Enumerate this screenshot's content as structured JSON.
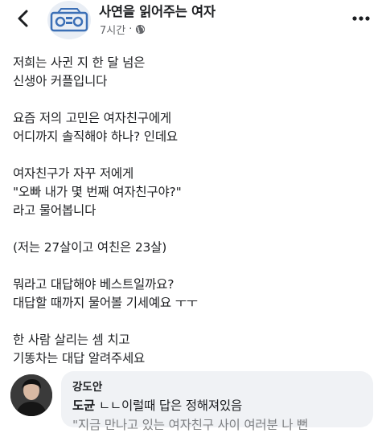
{
  "header": {
    "page_name": "사연을 읽어주는 여자",
    "time": "7시간",
    "separator": "·",
    "back_icon": "chevron-left-icon",
    "privacy_icon": "globe-icon",
    "more_icon": "more-horizontal-icon"
  },
  "post": {
    "paragraphs": [
      [
        "저희는 사귄 지 한 달 넘은",
        "신생아 커플입니다"
      ],
      [
        "요즘 저의 고민은 여자친구에게",
        "어디까지 솔직해야 하나? 인데요"
      ],
      [
        "여자친구가 자꾸 저에게",
        "\"오빠 내가 몇 번째 여자친구야?\"",
        "라고 물어봅니다"
      ],
      [
        "(저는 27살이고 여친은 23살)"
      ],
      [
        "뭐라고 대답해야 베스트일까요?",
        "대답할 때까지 물어볼 기세예요 ㅜㅜ"
      ],
      [
        "한 사람 살리는 셈 치고",
        "기똥차는 대답 알려주세요"
      ]
    ]
  },
  "comment": {
    "author": "강도안",
    "tagged_name": "도균",
    "text": "ㄴㄴ이럴때 답은 정해져있음",
    "text_partial": "\"지금 만나고 있는 여자친구 사이 여러분 나 뻔"
  },
  "colors": {
    "text": "#1c1e21",
    "secondary": "#65676b",
    "bubble": "#f0f2f5",
    "avatar_icon": "#3b6fb6"
  }
}
